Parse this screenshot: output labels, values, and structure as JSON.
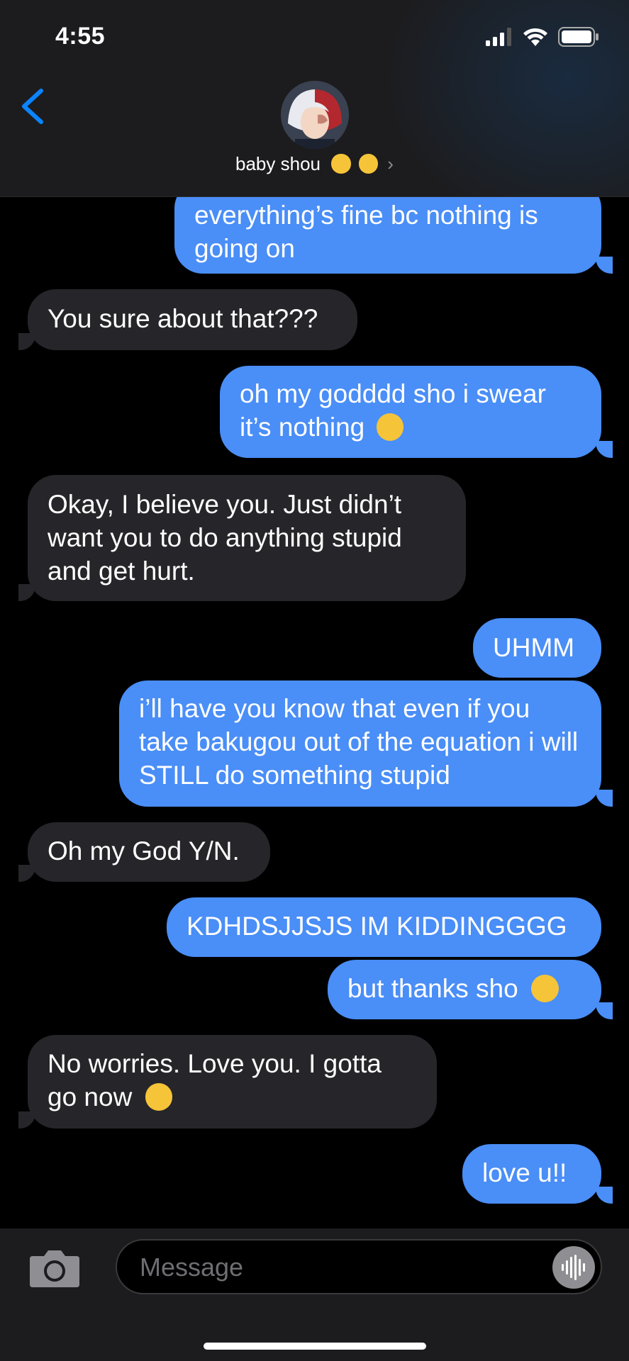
{
  "status_bar": {
    "time": "4:55"
  },
  "header": {
    "contact_name": "baby shou"
  },
  "messages": [
    {
      "side": "sent",
      "text": "everything’s fine bc nothing is going on"
    },
    {
      "side": "recv",
      "text": "You sure about that???"
    },
    {
      "side": "sent",
      "text": "oh my godddd sho i swear it’s nothing"
    },
    {
      "side": "recv",
      "text": "Okay, I believe you. Just didn’t want you to do anything stupid and get hurt."
    },
    {
      "side": "sent",
      "text": "UHMM"
    },
    {
      "side": "sent",
      "text": "i’ll have you know that even if you take bakugou out of the equation i will STILL do something stupid"
    },
    {
      "side": "recv",
      "text": "Oh my God Y/N."
    },
    {
      "side": "sent",
      "text": "KDHDSJJSJS IM KIDDINGGGG"
    },
    {
      "side": "sent",
      "text": "but thanks sho"
    },
    {
      "side": "recv",
      "text": "No worries. Love you. I gotta go now"
    },
    {
      "side": "sent",
      "text": "love u!!"
    }
  ],
  "input": {
    "placeholder": "Message"
  },
  "colors": {
    "sent_bubble": "#4a8ef7",
    "received_bubble": "#26262a",
    "accent": "#0a84ff"
  },
  "icons": [
    "back-chevron-icon",
    "signal-icon",
    "wifi-icon",
    "battery-icon",
    "camera-icon",
    "audio-waveform-icon",
    "pleading-face-emoji",
    "smiling-face-with-hearts-emoji",
    "sneezing-face-emoji",
    "halo-face-emoji"
  ]
}
